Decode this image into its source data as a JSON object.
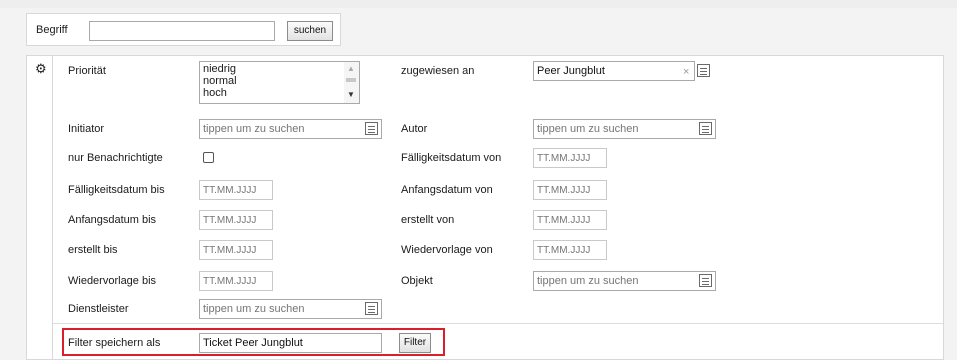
{
  "search": {
    "label": "Begriff",
    "value": "",
    "button": "suchen"
  },
  "filter": {
    "priority_label": "Priorität",
    "priority_options": [
      "niedrig",
      "normal",
      "hoch"
    ],
    "assigned_label": "zugewiesen an",
    "assigned_value": "Peer Jungblut",
    "initiator_label": "Initiator",
    "author_label": "Autor",
    "lookup_placeholder": "tippen um zu suchen",
    "notified_label": "nur Benachrichtigte",
    "due_from_label": "Fälligkeitsdatum von",
    "due_to_label": "Fälligkeitsdatum bis",
    "start_from_label": "Anfangsdatum von",
    "start_to_label": "Anfangsdatum bis",
    "created_from_label": "erstellt von",
    "created_to_label": "erstellt bis",
    "resubmit_from_label": "Wiedervorlage von",
    "resubmit_to_label": "Wiedervorlage bis",
    "object_label": "Objekt",
    "provider_label": "Dienstleister",
    "date_placeholder": "TT.MM.JJJJ",
    "save_label": "Filter speichern als",
    "save_value": "Ticket Peer Jungblut",
    "filter_button": "Filter"
  },
  "colors": {
    "highlight": "#d9202a"
  }
}
